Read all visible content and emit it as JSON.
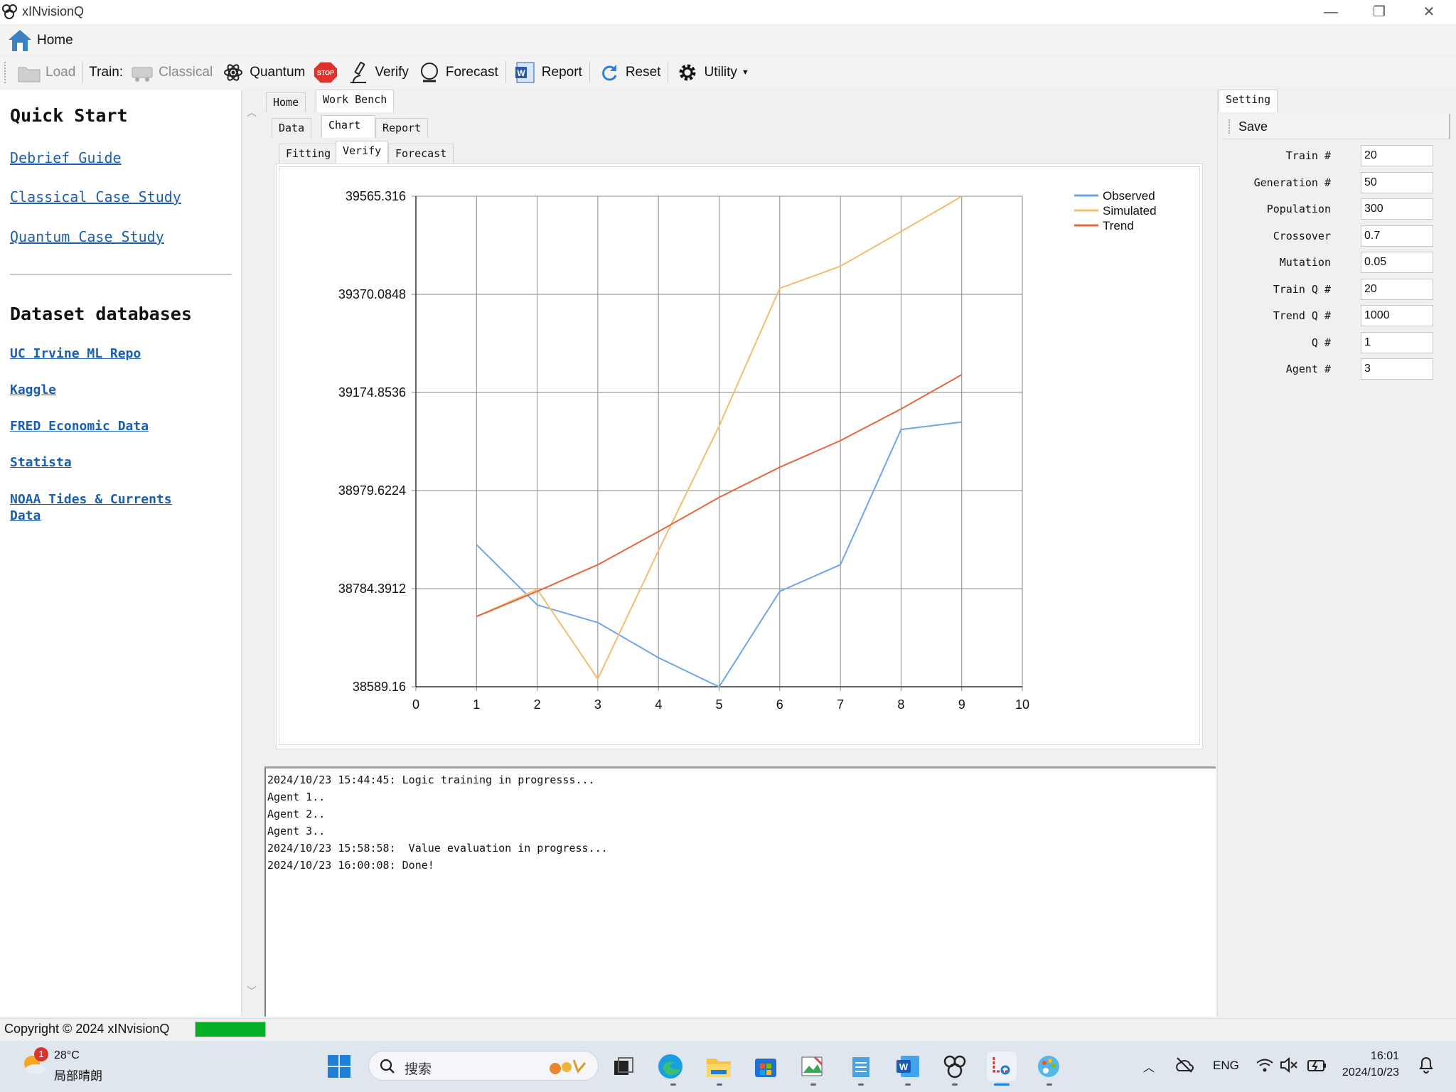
{
  "window": {
    "title": "xINvisionQ",
    "minimize": "—",
    "maximize": "❐",
    "close": "✕"
  },
  "menu": {
    "home_label": "Home"
  },
  "toolbar": {
    "load": "Load",
    "train_label": "Train:",
    "classical": "Classical",
    "quantum": "Quantum",
    "stop": "STOP",
    "verify": "Verify",
    "forecast": "Forecast",
    "report": "Report",
    "reset": "Reset",
    "utility": "Utility"
  },
  "sidebar": {
    "quick_start_title": "Quick Start",
    "quick_links": [
      "Debrief Guide",
      "Classical Case Study",
      "Quantum Case Study"
    ],
    "datasets_title": "Dataset databases",
    "dataset_links": [
      "UC Irvine ML Repo",
      "Kaggle",
      "FRED Economic Data",
      "Statista",
      "NOAA Tides & Currents Data"
    ]
  },
  "tabs": {
    "main": [
      "Home",
      "Work Bench"
    ],
    "sub": [
      "Data",
      "Chart",
      "Report"
    ],
    "chart_tabs": [
      "Fitting",
      "Verify",
      "Forecast"
    ]
  },
  "chart_data": {
    "type": "line",
    "x": [
      1,
      2,
      3,
      4,
      5,
      6,
      7,
      8,
      9
    ],
    "xlim": [
      0,
      10
    ],
    "xticks": [
      "0",
      "1",
      "2",
      "3",
      "4",
      "5",
      "6",
      "7",
      "8",
      "9",
      "10"
    ],
    "ylim": [
      38589.16,
      39565.316
    ],
    "yticks": [
      "39565.316",
      "39370.0848",
      "39174.8536",
      "38979.6224",
      "38784.3912",
      "38589.16"
    ],
    "grid": true,
    "legend_position": "top-right",
    "series": [
      {
        "name": "Observed",
        "color": "#6aa6f0",
        "values": [
          38872,
          38752,
          38717,
          38647,
          38589,
          38779,
          38832,
          39101,
          39116
        ]
      },
      {
        "name": "Simulated",
        "color": "#f5bd6b",
        "values": [
          38729,
          38783,
          38605,
          38860,
          39108,
          39382,
          39426,
          39495,
          39565
        ]
      },
      {
        "name": "Trend",
        "color": "#e8643c",
        "values": [
          38729,
          38779,
          38832,
          38898,
          38966,
          39026,
          39079,
          39142,
          39210
        ]
      }
    ]
  },
  "log": {
    "lines": [
      "2024/10/23 15:44:45: Logic training in progresss...",
      "Agent 1..",
      "Agent 2..",
      "Agent 3..",
      "2024/10/23 15:58:58:  Value evaluation in progress...",
      "2024/10/23 16:00:08: Done!"
    ]
  },
  "settings": {
    "tab": "Setting",
    "save": "Save",
    "fields": [
      {
        "label": "Train #",
        "value": "20"
      },
      {
        "label": "Generation #",
        "value": "50"
      },
      {
        "label": "Population",
        "value": "300"
      },
      {
        "label": "Crossover",
        "value": "0.7"
      },
      {
        "label": "Mutation",
        "value": "0.05"
      },
      {
        "label": "Train Q #",
        "value": "20"
      },
      {
        "label": "Trend Q #",
        "value": "1000"
      },
      {
        "label": "Q #",
        "value": "1"
      },
      {
        "label": "Agent #",
        "value": "3"
      }
    ]
  },
  "status": {
    "copyright": "Copyright © 2024 xINvisionQ",
    "progress": 1.0
  },
  "taskbar": {
    "weather_temp": "28°C",
    "weather_desc": "局部晴朗",
    "weather_badge": "1",
    "search_placeholder": "搜索",
    "lang": "ENG",
    "time": "16:01",
    "date": "2024/10/23"
  }
}
